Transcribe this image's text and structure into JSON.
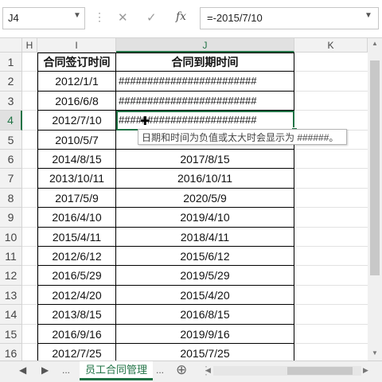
{
  "formula_bar": {
    "name_box": "J4",
    "formula": "=-2015/7/10",
    "dots": "⋮",
    "cancel_icon": "✕",
    "enter_icon": "✓",
    "fx_label": "fx"
  },
  "columns": [
    "H",
    "I",
    "J",
    "K"
  ],
  "headers": {
    "col_i": "合同签订时间",
    "col_j": "合同到期时间"
  },
  "rows": [
    {
      "num": "1",
      "i": "合同签订时间",
      "j": "合同到期时间"
    },
    {
      "num": "2",
      "i": "2012/1/1",
      "j": "########################"
    },
    {
      "num": "3",
      "i": "2016/6/8",
      "j": "########################"
    },
    {
      "num": "4",
      "i": "2012/7/10",
      "j": "########################"
    },
    {
      "num": "5",
      "i": "2010/5/7",
      "j": ""
    },
    {
      "num": "6",
      "i": "2014/8/15",
      "j": "2017/8/15"
    },
    {
      "num": "7",
      "i": "2013/10/11",
      "j": "2016/10/11"
    },
    {
      "num": "8",
      "i": "2017/5/9",
      "j": "2020/5/9"
    },
    {
      "num": "9",
      "i": "2016/4/10",
      "j": "2019/4/10"
    },
    {
      "num": "10",
      "i": "2015/4/11",
      "j": "2018/4/11"
    },
    {
      "num": "11",
      "i": "2012/6/12",
      "j": "2015/6/12"
    },
    {
      "num": "12",
      "i": "2016/5/29",
      "j": "2019/5/29"
    },
    {
      "num": "13",
      "i": "2012/4/20",
      "j": "2015/4/20"
    },
    {
      "num": "14",
      "i": "2013/8/15",
      "j": "2016/8/15"
    },
    {
      "num": "15",
      "i": "2016/9/16",
      "j": "2019/9/16"
    },
    {
      "num": "16",
      "i": "2012/7/25",
      "j": "2015/7/25"
    }
  ],
  "tooltip": "日期和时间为负值或太大时会显示为 ######。",
  "tabs": {
    "prev": "◀",
    "next": "▶",
    "more_left": "...",
    "sheet": "员工合同管理",
    "more_right": "...",
    "add": "⊕"
  },
  "colors": {
    "excel_green": "#217346",
    "header_bg": "#f2f2f2"
  }
}
